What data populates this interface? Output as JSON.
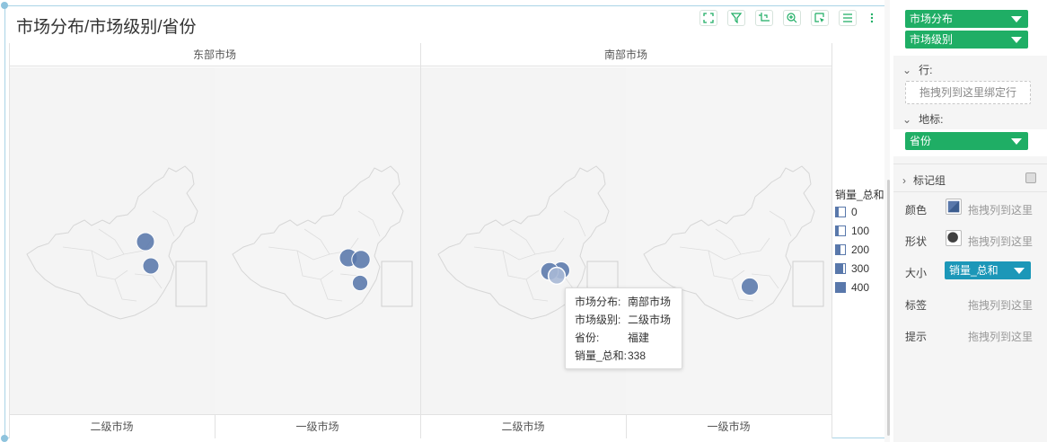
{
  "title": "市场分布/市场级别/省份",
  "toolbar": {
    "icons": [
      "expand-icon",
      "filter-icon",
      "crop-axis-icon",
      "zoom-in-icon",
      "select-icon",
      "list-icon",
      "more-icon"
    ]
  },
  "columns": [
    {
      "label": "东部市场"
    },
    {
      "label": "南部市场"
    }
  ],
  "rows": [
    {
      "label": "二级市场"
    },
    {
      "label": "一级市场"
    },
    {
      "label": "二级市场"
    },
    {
      "label": "一级市场"
    }
  ],
  "colors": {
    "bubble": "#5978ab",
    "hover_bubble": "#a9b9d6",
    "green_pill": "#1fae65",
    "teal_pill": "#1c97b8",
    "panel_border": "#a9d3e6"
  },
  "chart_data": {
    "type": "scatter",
    "title": "市场分布/市场级别/省份",
    "size_field": "销量_总和",
    "panels": [
      {
        "market": "东部市场",
        "level": "二级市场",
        "points": [
          {
            "province": "",
            "value": 400
          },
          {
            "province": "",
            "value": 300
          }
        ]
      },
      {
        "market": "东部市场",
        "level": "一级市场",
        "points": [
          {
            "province": "",
            "value": 400
          },
          {
            "province": "",
            "value": 420
          },
          {
            "province": "",
            "value": 260
          }
        ]
      },
      {
        "market": "南部市场",
        "level": "二级市场",
        "points": [
          {
            "province": "",
            "value": 350
          },
          {
            "province": "",
            "value": 380
          },
          {
            "province": "福建",
            "value": 338
          }
        ]
      },
      {
        "market": "南部市场",
        "level": "一级市场",
        "points": [
          {
            "province": "",
            "value": 360
          }
        ]
      }
    ]
  },
  "legend": {
    "title": "销量_总和",
    "items": [
      {
        "label": "0",
        "fill": 0.0
      },
      {
        "label": "100",
        "fill": 0.25
      },
      {
        "label": "200",
        "fill": 0.5
      },
      {
        "label": "300",
        "fill": 0.75
      },
      {
        "label": "400",
        "fill": 1.0
      }
    ]
  },
  "tooltip": {
    "rows": [
      {
        "key": "市场分布:",
        "value": "南部市场"
      },
      {
        "key": "市场级别:",
        "value": "二级市场"
      },
      {
        "key": "省份:",
        "value": "福建"
      },
      {
        "key": "销量_总和:",
        "value": "338"
      }
    ]
  },
  "config": {
    "column_pills": [
      "市场分布",
      "市场级别"
    ],
    "row_shelf": {
      "label": "行:",
      "placeholder": "拖拽列到这里绑定行"
    },
    "geo_shelf": {
      "label": "地标:",
      "pill": "省份"
    },
    "marks": {
      "label": "标记组",
      "items": [
        {
          "label": "颜色",
          "hint": "拖拽列到这里",
          "swatch": "color-swatch-icon"
        },
        {
          "label": "形状",
          "hint": "拖拽列到这里",
          "swatch": "shape-circle-icon"
        },
        {
          "label": "大小",
          "pill": "销量_总和"
        },
        {
          "label": "标签",
          "hint": "拖拽列到这里"
        },
        {
          "label": "提示",
          "hint": "拖拽列到这里"
        }
      ]
    }
  }
}
